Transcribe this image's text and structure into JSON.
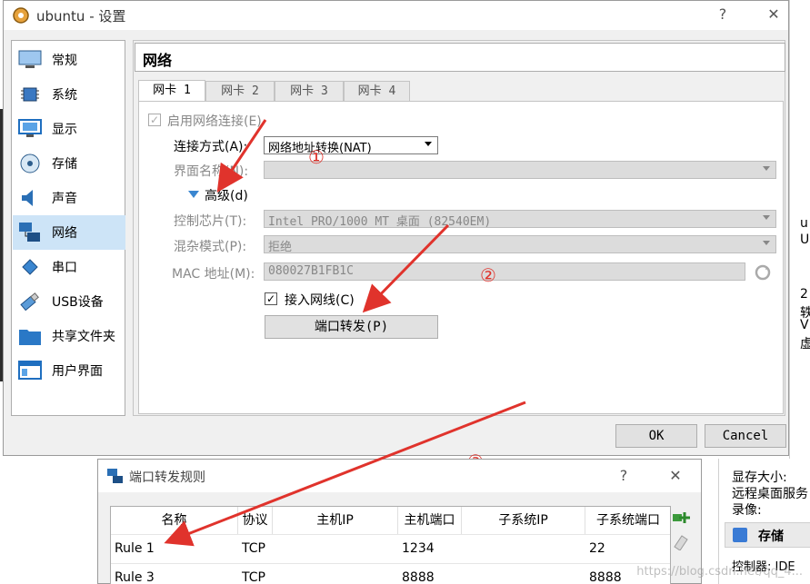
{
  "window": {
    "title": "ubuntu - 设置",
    "help": "?",
    "close": "✕"
  },
  "sidebar": {
    "items": [
      {
        "label": "常规",
        "icon": "monitor-icon"
      },
      {
        "label": "系统",
        "icon": "chip-icon"
      },
      {
        "label": "显示",
        "icon": "display-icon"
      },
      {
        "label": "存储",
        "icon": "disk-icon"
      },
      {
        "label": "声音",
        "icon": "speaker-icon"
      },
      {
        "label": "网络",
        "icon": "network-icon"
      },
      {
        "label": "串口",
        "icon": "serial-port-icon"
      },
      {
        "label": "USB设备",
        "icon": "usb-icon"
      },
      {
        "label": "共享文件夹",
        "icon": "folder-icon"
      },
      {
        "label": "用户界面",
        "icon": "window-icon"
      }
    ],
    "selected": "网络"
  },
  "section_title": "网络",
  "tabs": [
    "网卡 1",
    "网卡 2",
    "网卡 3",
    "网卡 4"
  ],
  "network": {
    "enable_label": "启用网络连接(E)",
    "enable_checked": true,
    "attach_label": "连接方式(A):",
    "attach_value": "网络地址转换(NAT)",
    "name_label": "界面名称(N):",
    "name_value": "",
    "advanced_label": "高级(d)",
    "adapter_label": "控制芯片(T):",
    "adapter_value": "Intel PRO/1000 MT 桌面 (82540EM)",
    "promisc_label": "混杂模式(P):",
    "promisc_value": "拒绝",
    "mac_label": "MAC 地址(M):",
    "mac_value": "080027B1FB1C",
    "cable_label": "接入网线(C)",
    "cable_checked": true,
    "port_forward_button": "端口转发(P)"
  },
  "markers": {
    "one": "①",
    "two": "②",
    "three": "③"
  },
  "buttons": {
    "ok": "OK",
    "cancel": "Cancel"
  },
  "port_dialog": {
    "title": "端口转发规则",
    "help": "?",
    "close": "✕",
    "columns": [
      "名称",
      "协议",
      "主机IP",
      "主机端口",
      "子系统IP",
      "子系统端口"
    ],
    "rows": [
      {
        "name": "Rule 1",
        "protocol": "TCP",
        "host_ip": "",
        "host_port": "1234",
        "guest_ip": "",
        "guest_port": "22"
      },
      {
        "name": "Rule 3",
        "protocol": "TCP",
        "host_ip": "",
        "host_port": "8888",
        "guest_ip": "",
        "guest_port": "8888"
      }
    ]
  },
  "background_app": {
    "lines": [
      "显存大小:",
      "远程桌面服务",
      "录像:"
    ],
    "storage_title": "存储",
    "controller": "控制器: IDE",
    "edge_chars": [
      "u",
      "U",
      "2",
      "轶",
      "V",
      "虚"
    ]
  },
  "watermark": "https://blog.csdn.net/qq_4..."
}
